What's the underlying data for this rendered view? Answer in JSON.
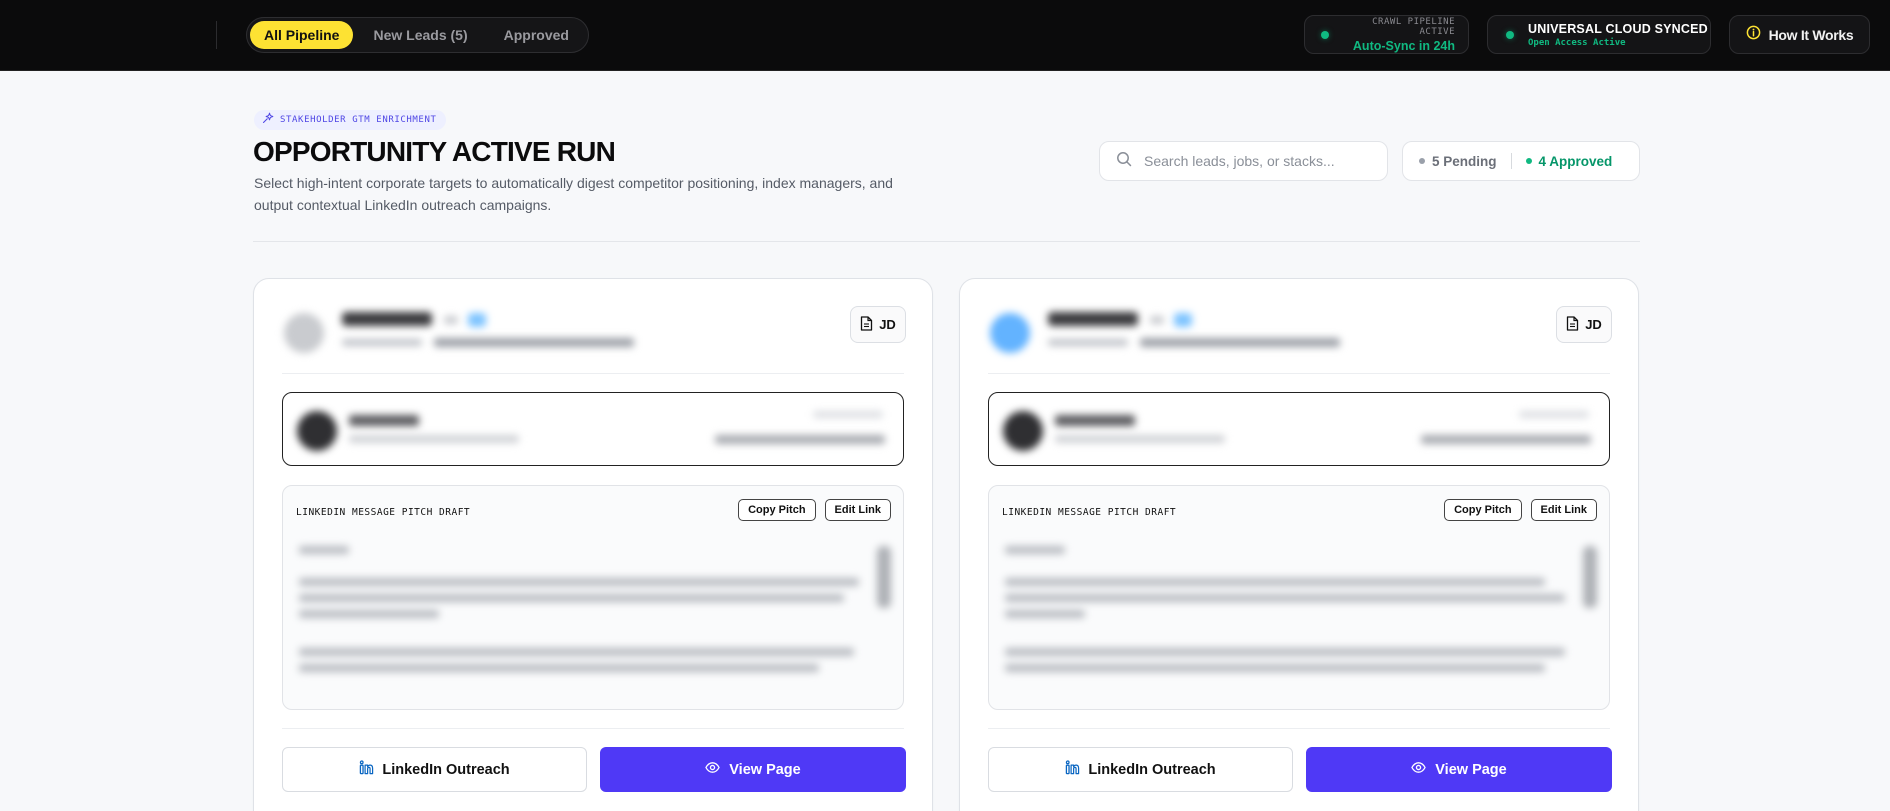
{
  "topbar": {
    "tabs": [
      {
        "label": "All Pipeline",
        "active": true
      },
      {
        "label": "New Leads (5)",
        "active": false
      },
      {
        "label": "Approved",
        "active": false
      }
    ],
    "crawl": {
      "label": "CRAWL PIPELINE ACTIVE",
      "value": "Auto-Sync in 24h"
    },
    "cloud": {
      "label": "UNIVERSAL CLOUD SYNCED",
      "value": "Open Access Active"
    },
    "how_label": "How It Works"
  },
  "header": {
    "badge": "STAKEHOLDER GTM ENRICHMENT",
    "title": "OPPORTUNITY ACTIVE RUN",
    "subtitle": "Select high-intent corporate targets to automatically digest competitor positioning, index managers, and output contextual LinkedIn outreach campaigns.",
    "search_placeholder": "Search leads, jobs, or stacks...",
    "pending": "5 Pending",
    "approved": "4 Approved"
  },
  "cards": [
    {
      "jd_label": "JD",
      "pitch_label": "LINKEDIN MESSAGE PITCH DRAFT",
      "copy_label": "Copy Pitch",
      "edit_label": "Edit Link",
      "linkedin_label": "LinkedIn Outreach",
      "view_label": "View Page"
    },
    {
      "jd_label": "JD",
      "pitch_label": "LINKEDIN MESSAGE PITCH DRAFT",
      "copy_label": "Copy Pitch",
      "edit_label": "Edit Link",
      "linkedin_label": "LinkedIn Outreach",
      "view_label": "View Page"
    }
  ],
  "colors": {
    "accent_yellow": "#fde233",
    "status_green": "#10b981",
    "primary_indigo": "#4f39f6",
    "linkedin_blue": "#0a66c2"
  },
  "icons": {
    "sparkle": "sparkle-icon",
    "info": "info-icon",
    "search": "search-icon",
    "document": "document-icon",
    "linkedin": "linkedin-icon",
    "eye": "eye-icon"
  }
}
